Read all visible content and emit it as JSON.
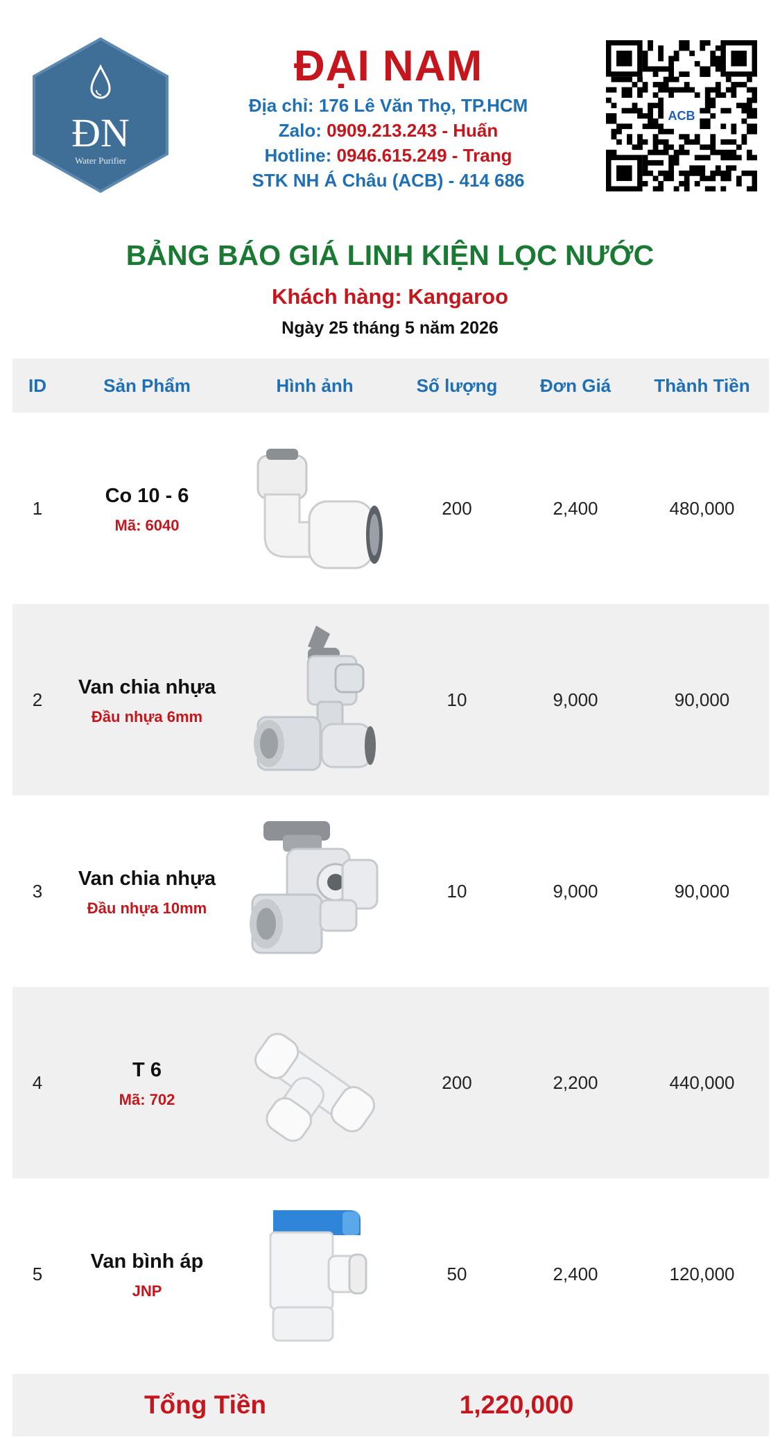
{
  "company": {
    "logo_text": "ĐN",
    "logo_subtext": "Water Purifier",
    "name": "ĐẠI NAM",
    "address_label": "Địa chỉ: 176 Lê Văn Thọ, TP.HCM",
    "zalo_label": "Zalo: ",
    "zalo_value": "0909.213.243 - Huấn",
    "hotline_label": "Hotline: ",
    "hotline_value": "0946.615.249 - Trang",
    "bank_label": "STK NH Á Châu (ACB) - ",
    "bank_value": "414 686",
    "qr_badge": "ACB",
    "colors": {
      "brand_red": "#c4161c",
      "blue": "#1f6fb5",
      "green": "#1a7a34",
      "logo_bg": "#3f6e96"
    }
  },
  "quote": {
    "title": "BẢNG BÁO GIÁ LINH KIỆN LỌC NƯỚC",
    "customer": "Khách hàng: Kangaroo",
    "date": "Ngày 25 tháng 5 năm 2026"
  },
  "table": {
    "headers": [
      "ID",
      "Sản Phẩm",
      "Hình ảnh",
      "Số lượng",
      "Đơn Giá",
      "Thành Tiền"
    ],
    "rows": [
      {
        "id": "1",
        "name": "Co 10 - 6",
        "sub": "Mã: 6040",
        "image": "elbow-fitting-icon",
        "qty": "200",
        "price": "2,400",
        "total": "480,000"
      },
      {
        "id": "2",
        "name": "Van chia nhựa",
        "sub": "Đầu nhựa 6mm",
        "image": "split-valve-icon",
        "qty": "10",
        "price": "9,000",
        "total": "90,000"
      },
      {
        "id": "3",
        "name": "Van chia nhựa",
        "sub": "Đầu  nhựa 10mm",
        "image": "split-valve-icon",
        "qty": "10",
        "price": "9,000",
        "total": "90,000"
      },
      {
        "id": "4",
        "name": "T 6",
        "sub": "Mã: 702",
        "image": "tee-fitting-icon",
        "qty": "200",
        "price": "2,200",
        "total": "440,000"
      },
      {
        "id": "5",
        "name": "Van bình áp",
        "sub": "JNP",
        "image": "tank-valve-icon",
        "qty": "50",
        "price": "2,400",
        "total": "120,000"
      }
    ],
    "total_label": "Tổng Tiền",
    "total_value": "1,220,000"
  }
}
